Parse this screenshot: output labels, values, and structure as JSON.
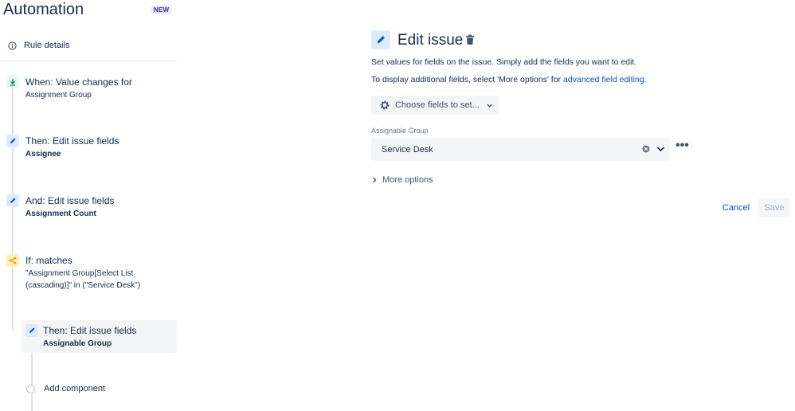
{
  "app": {
    "title": "Automation",
    "badge": "NEW"
  },
  "rule_details": {
    "label": "Rule details",
    "icon": "info-icon"
  },
  "steps": [
    {
      "title": "When: Value changes for",
      "subtitle": "Assignment Group",
      "icon": "trigger-icon",
      "color": "#e3fcef"
    },
    {
      "title": "Then: Edit issue fields",
      "subtitle": "Assignee",
      "icon": "pencil-icon",
      "color": "#deebff"
    },
    {
      "title": "And: Edit issue fields",
      "subtitle": "Assignment Count",
      "icon": "pencil-icon",
      "color": "#deebff"
    },
    {
      "title": "If: matches",
      "subtitle": "\"Assignment Group[Select List (cascading)]\" in (\"Service Desk\")",
      "icon": "branch-icon",
      "color": "#fff0b3"
    },
    {
      "title": "Then: Edit issue fields",
      "subtitle": "Assignable Group",
      "icon": "pencil-icon",
      "color": "#deebff",
      "selected": true
    }
  ],
  "add_component": "Add component",
  "editor": {
    "title": "Edit issue",
    "desc1": "Set values for fields on the issue. Simply add the fields you want to edit.",
    "desc2_prefix": "To display additional fields, select 'More options' for ",
    "desc2_link": "advanced field editing",
    "desc2_suffix": ".",
    "choose_fields": "Choose fields to set...",
    "field_label": "Assignable Group",
    "field_value": "Service Desk",
    "more_dots": "•••",
    "more_options": "More options",
    "cancel": "Cancel",
    "save": "Save"
  }
}
